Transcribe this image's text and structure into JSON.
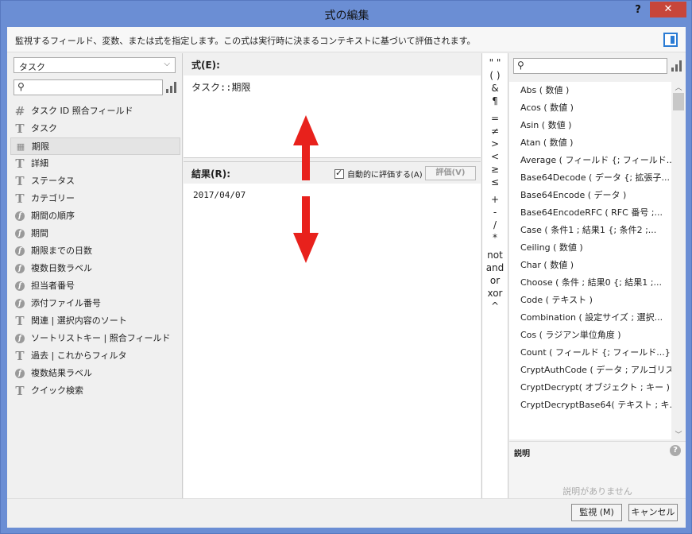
{
  "window": {
    "title": "式の編集",
    "help": "?",
    "close": "✕"
  },
  "description": "監視するフィールド、変数、または式を指定します。この式は実行時に決まるコンテキストに基づいて評価されます。",
  "left": {
    "table_select": "タスク",
    "search_placeholder": "",
    "fields": [
      {
        "label": "タスク ID 照合フィールド",
        "icon": "hash-icon"
      },
      {
        "label": "タスク",
        "icon": "text-field-icon"
      },
      {
        "label": "期限",
        "icon": "date-field-icon",
        "selected": true
      },
      {
        "label": "詳細",
        "icon": "text-field-icon"
      },
      {
        "label": "ステータス",
        "icon": "text-field-icon"
      },
      {
        "label": "カテゴリー",
        "icon": "text-field-icon"
      },
      {
        "label": "期間の順序",
        "icon": "calc-field-icon"
      },
      {
        "label": "期間",
        "icon": "calc-field-icon"
      },
      {
        "label": "期限までの日数",
        "icon": "calc-field-icon"
      },
      {
        "label": "複数日数ラベル",
        "icon": "calc-field-icon"
      },
      {
        "label": "担当者番号",
        "icon": "calc-field-icon"
      },
      {
        "label": "添付ファイル番号",
        "icon": "calc-field-icon"
      },
      {
        "label": "関連 | 選択内容のソート",
        "icon": "text-field-icon"
      },
      {
        "label": "ソートリストキー | 照合フィールド",
        "icon": "calc-field-icon"
      },
      {
        "label": "過去 | これからフィルタ",
        "icon": "text-field-icon"
      },
      {
        "label": "複数結果ラベル",
        "icon": "calc-field-icon"
      },
      {
        "label": "クイック検索",
        "icon": "text-field-icon"
      }
    ]
  },
  "expression": {
    "header": "式(E):",
    "text": "タスク::期限"
  },
  "result": {
    "header": "結果(R):",
    "auto_eval_label": "自動的に評価する(A)",
    "auto_eval_checked": true,
    "eval_button": "評価(V)",
    "value": "2017/04/07"
  },
  "operators": [
    "\" \"",
    "( )",
    "&",
    "¶",
    "=",
    "≠",
    ">",
    "<",
    "≥",
    "≤",
    "+",
    "-",
    "/",
    "*",
    "not",
    "and",
    "or",
    "xor",
    "^"
  ],
  "right": {
    "search_placeholder": "",
    "functions": [
      "Abs ( 数値 )",
      "Acos ( 数値 )",
      "Asin ( 数値 )",
      "Atan ( 数値 )",
      "Average ( フィールド {; フィールド...} )",
      "Base64Decode ( データ {; 拡張子...",
      "Base64Encode ( データ )",
      "Base64EncodeRFC ( RFC 番号 ;...",
      "Case ( 条件1 ; 結果1 {; 条件2 ;...",
      "Ceiling ( 数値 )",
      "Char ( 数値 )",
      "Choose ( 条件 ; 結果0 {; 結果1 ;...",
      "Code ( テキスト )",
      "Combination ( 設定サイズ ; 選択...",
      "Cos ( ラジアン単位角度 )",
      "Count ( フィールド {; フィールド...} )",
      "CryptAuthCode ( データ ; アルゴリズ...",
      "CryptDecrypt( オブジェクト ; キー )",
      "CryptDecryptBase64( テキスト ; キ..."
    ],
    "help_header": "説明",
    "help_empty": "説明がありません"
  },
  "footer": {
    "monitor_button": "監視 (M)",
    "cancel_button": "キャンセル"
  },
  "colors": {
    "titlebar": "#6b8ed4",
    "close": "#c7463a",
    "arrow": "#e8211c",
    "accent": "#2a7bd4"
  }
}
